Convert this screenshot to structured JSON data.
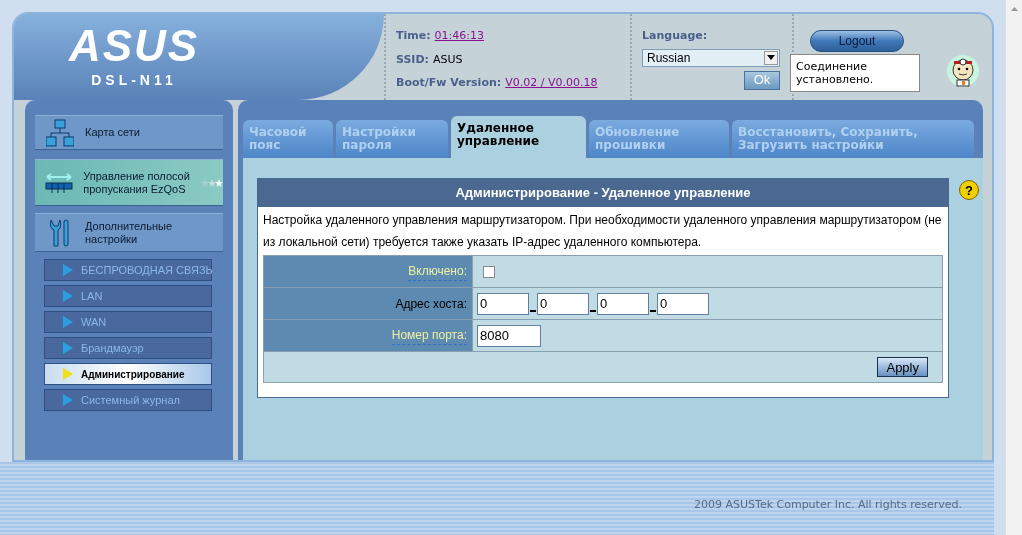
{
  "header": {
    "logo": "ASUS",
    "model": "DSL-N11",
    "time_label": "Time:",
    "time": "01:46:13",
    "ssid_label": "SSID:",
    "ssid": "ASUS",
    "version_label": "Boot/Fw Version:",
    "version": "V0.02 / V0.00.18",
    "language_label": "Language:",
    "language": "Russian",
    "ok_button": "Ok",
    "logout_button": "Logout",
    "status": "Соединение установлено."
  },
  "sidebar": {
    "main_items": [
      {
        "label": "Карта сети",
        "kind": "map"
      },
      {
        "label": "Управление полосой пропускания EzQoS",
        "kind": "qos"
      },
      {
        "label": "Дополнительные настройки",
        "kind": "tools"
      }
    ],
    "sub_items": [
      {
        "label": "БЕСПРОВОДНАЯ СВЯЗЬ",
        "selected": false
      },
      {
        "label": "LAN",
        "selected": false
      },
      {
        "label": "WAN",
        "selected": false
      },
      {
        "label": "Брандмауэр",
        "selected": false
      },
      {
        "label": "Администрирование",
        "selected": true
      },
      {
        "label": "Системный журнал",
        "selected": false
      }
    ]
  },
  "tabs": [
    {
      "label": "Часовой пояс",
      "selected": false
    },
    {
      "label": "Настройки пароля",
      "selected": false
    },
    {
      "label": "Удаленное управление",
      "selected": true
    },
    {
      "label": "Обновление прошивки",
      "selected": false
    },
    {
      "label": "Восстановить, Сохранить, Загрузить настройки",
      "selected": false
    }
  ],
  "panel": {
    "title": "Администрирование - Удаленное управление",
    "description": "Настройка удаленного управления маршрутизатором. При необходимости удаленного управления маршрутизатором (не из локальной сети) требуется также указать IP-адрес удаленного компьютера.",
    "fields": [
      {
        "label": "Включено:",
        "kind": "checkbox",
        "help": true,
        "checked": false
      },
      {
        "label": "Адрес хоста:",
        "kind": "ip",
        "help": false,
        "values": [
          "0",
          "0",
          "0",
          "0"
        ]
      },
      {
        "label": "Номер порта:",
        "kind": "text",
        "help": true,
        "value": "8080"
      }
    ],
    "apply_button": "Apply",
    "help_icon": "?"
  },
  "footer": "2009 ASUSTek Computer Inc. All rights reserved."
}
